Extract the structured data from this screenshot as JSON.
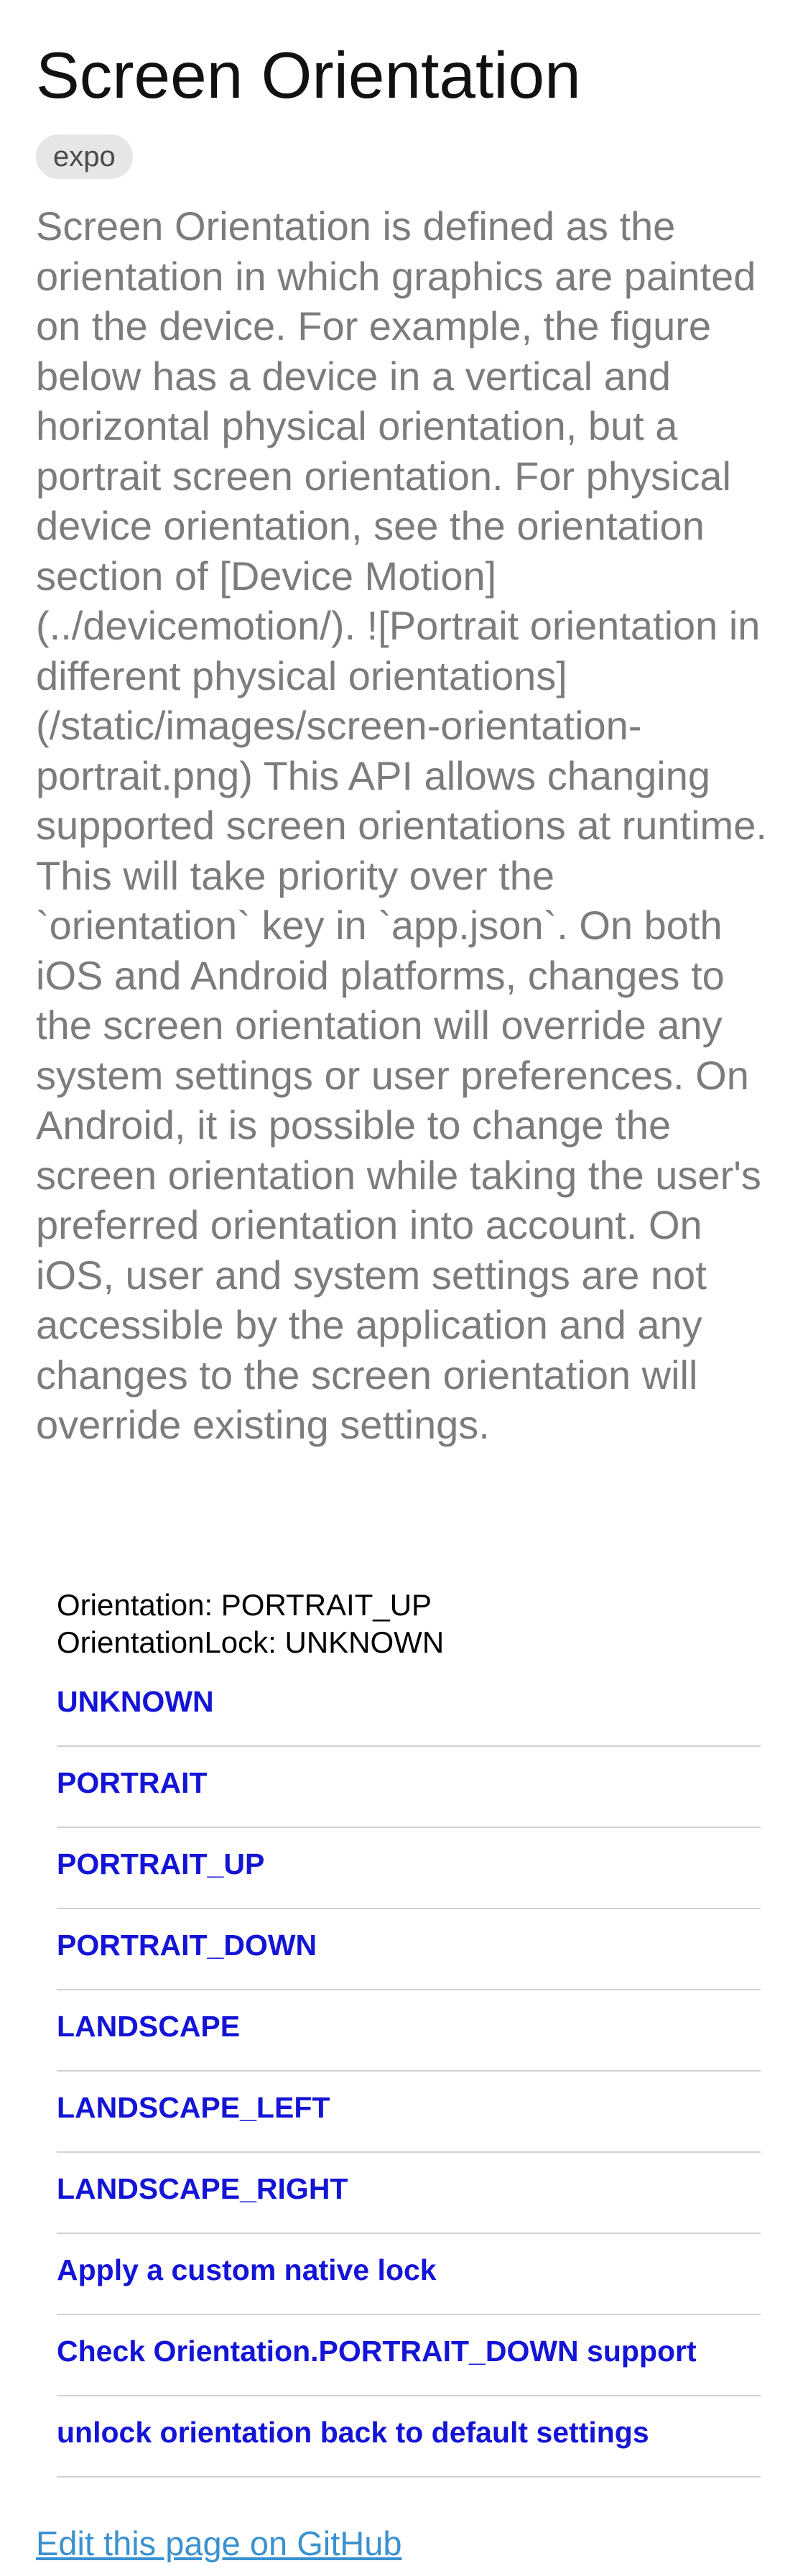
{
  "page": {
    "title": "Screen Orientation",
    "platform_tag": "expo",
    "description": "Screen Orientation is defined as the orientation in which graphics are painted on the device. For example, the figure below has a device in a vertical and horizontal physical orientation, but a portrait screen orientation. For physical device orientation, see the orientation section of [Device Motion](../devicemotion/). ![Portrait orientation in different physical orientations](/static/images/screen-orientation-portrait.png) This API allows changing supported screen orientations at runtime. This will take priority over the `orientation` key in `app.json`. On both iOS and Android platforms, changes to the screen orientation will override any system settings or user preferences. On Android, it is possible to change the screen orientation while taking the user's preferred orientation into account. On iOS, user and system settings are not accessible by the application and any changes to the screen orientation will override existing settings."
  },
  "example": {
    "orientation_text": "Orientation: PORTRAIT_UP",
    "orientation_lock_text": "OrientationLock: UNKNOWN",
    "buttons": [
      {
        "label": "UNKNOWN"
      },
      {
        "label": "PORTRAIT"
      },
      {
        "label": "PORTRAIT_UP"
      },
      {
        "label": "PORTRAIT_DOWN"
      },
      {
        "label": "LANDSCAPE"
      },
      {
        "label": "LANDSCAPE_LEFT"
      },
      {
        "label": "LANDSCAPE_RIGHT"
      },
      {
        "label": "Apply a custom native lock"
      },
      {
        "label": "Check Orientation.PORTRAIT_DOWN support"
      },
      {
        "label": "unlock orientation back to default settings"
      }
    ]
  },
  "footer": {
    "edit_link": "Edit this page on GitHub"
  },
  "colors": {
    "title": "#111111",
    "description_text": "#7c7c7c",
    "tag_background": "#e6e6e6",
    "button_text": "#1414d6",
    "divider": "#d1d1d1",
    "link": "#3a91cf"
  }
}
